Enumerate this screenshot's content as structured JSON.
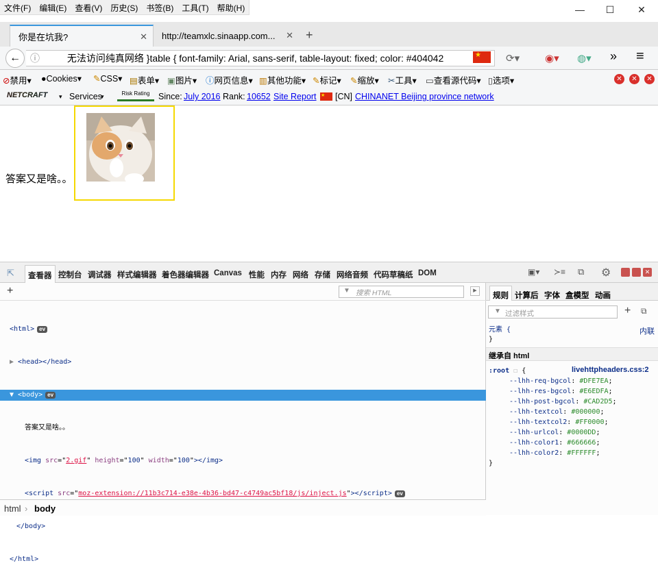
{
  "menubar": {
    "items": [
      "文件(F)",
      "编辑(E)",
      "查看(V)",
      "历史(S)",
      "书签(B)",
      "工具(T)",
      "帮助(H)"
    ],
    "minimize": "—",
    "maximize": "☐",
    "close": "✕"
  },
  "tabs": [
    {
      "title": "你是在坑我?"
    },
    {
      "title": "http://teamxlc.sinaapp.com..."
    }
  ],
  "tab_close": "✕",
  "new_tab": "+",
  "nav": {
    "back": "←",
    "info": "ⓘ",
    "url_text": "无法访问纯真网络 }table { font-family: Arial, sans-serif, table-layout: fixed; color: #404042",
    "more": "»",
    "menu": "≡"
  },
  "addon_toolbar": {
    "items": [
      "禁用▾",
      "Cookies▾",
      "CSS▾",
      "表单▾",
      "图片▾",
      "网页信息▾",
      "其他功能▾",
      "标记▾",
      "缩放▾",
      "工具▾",
      "查看源代码▾",
      "选项▾"
    ]
  },
  "netcraft": {
    "logo": "NETCRAFT",
    "services": "Services",
    "risk_rating": "Risk Rating",
    "since_label": "Since:",
    "since_value": "July 2016",
    "rank_label": "Rank:",
    "rank_value": "10652",
    "site_report": "Site Report",
    "country": "[CN]",
    "network": "CHINANET Beijing province network"
  },
  "page": {
    "text": "答案又是啥。。"
  },
  "devtools": {
    "tabs": [
      "查看器",
      "控制台",
      "调试器",
      "样式编辑器",
      "着色器编辑器",
      "Canvas",
      "性能",
      "内存",
      "网络",
      "存储",
      "网络音频",
      "代码草稿纸",
      "DOM"
    ],
    "search_placeholder": "搜索 HTML",
    "add": "+",
    "tree": {
      "html_open": "<html>",
      "head": "<head></head>",
      "body_open": "<body>",
      "text_node": "答案又是啥。。",
      "img_src": "2.gif",
      "img_height": "100",
      "img_width": "100",
      "script_src": "moz-extension://11b3c714-e38e-4b36-bd47-c4749ac5bf18/js/inject.js",
      "body_close": "</body>",
      "html_close": "</html>",
      "ev": "ev"
    },
    "breadcrumb": [
      "html",
      "body"
    ],
    "side_tabs": [
      "规则",
      "计算后",
      "字体",
      "盒模型",
      "动画"
    ],
    "filter_placeholder": "过滤样式",
    "element_rule": "元素 {",
    "element_close": "}",
    "inline_label": "内联",
    "inherited_header": "继承自 html",
    "root_selector": ":root",
    "root_source": "livehttpheaders.css:2",
    "vars": [
      {
        "name": "--lhh-req-bgcol",
        "value": "#DFE7EA"
      },
      {
        "name": "--lhh-res-bgcol",
        "value": "#E6EDFA"
      },
      {
        "name": "--lhh-post-bgcol",
        "value": "#CAD2D5"
      },
      {
        "name": "--lhh-textcol",
        "value": "#000000"
      },
      {
        "name": "--lhh-textcol2",
        "value": "#FF0000"
      },
      {
        "name": "--lhh-urlcol",
        "value": "#0000DD"
      },
      {
        "name": "--lhh-color1",
        "value": "#666666"
      },
      {
        "name": "--lhh-color2",
        "value": "#FFFFFF"
      }
    ]
  },
  "colors": {
    "accent": "#3a96dd",
    "selected_row": "#3a96dd",
    "highlight_border": "#f5d800"
  }
}
